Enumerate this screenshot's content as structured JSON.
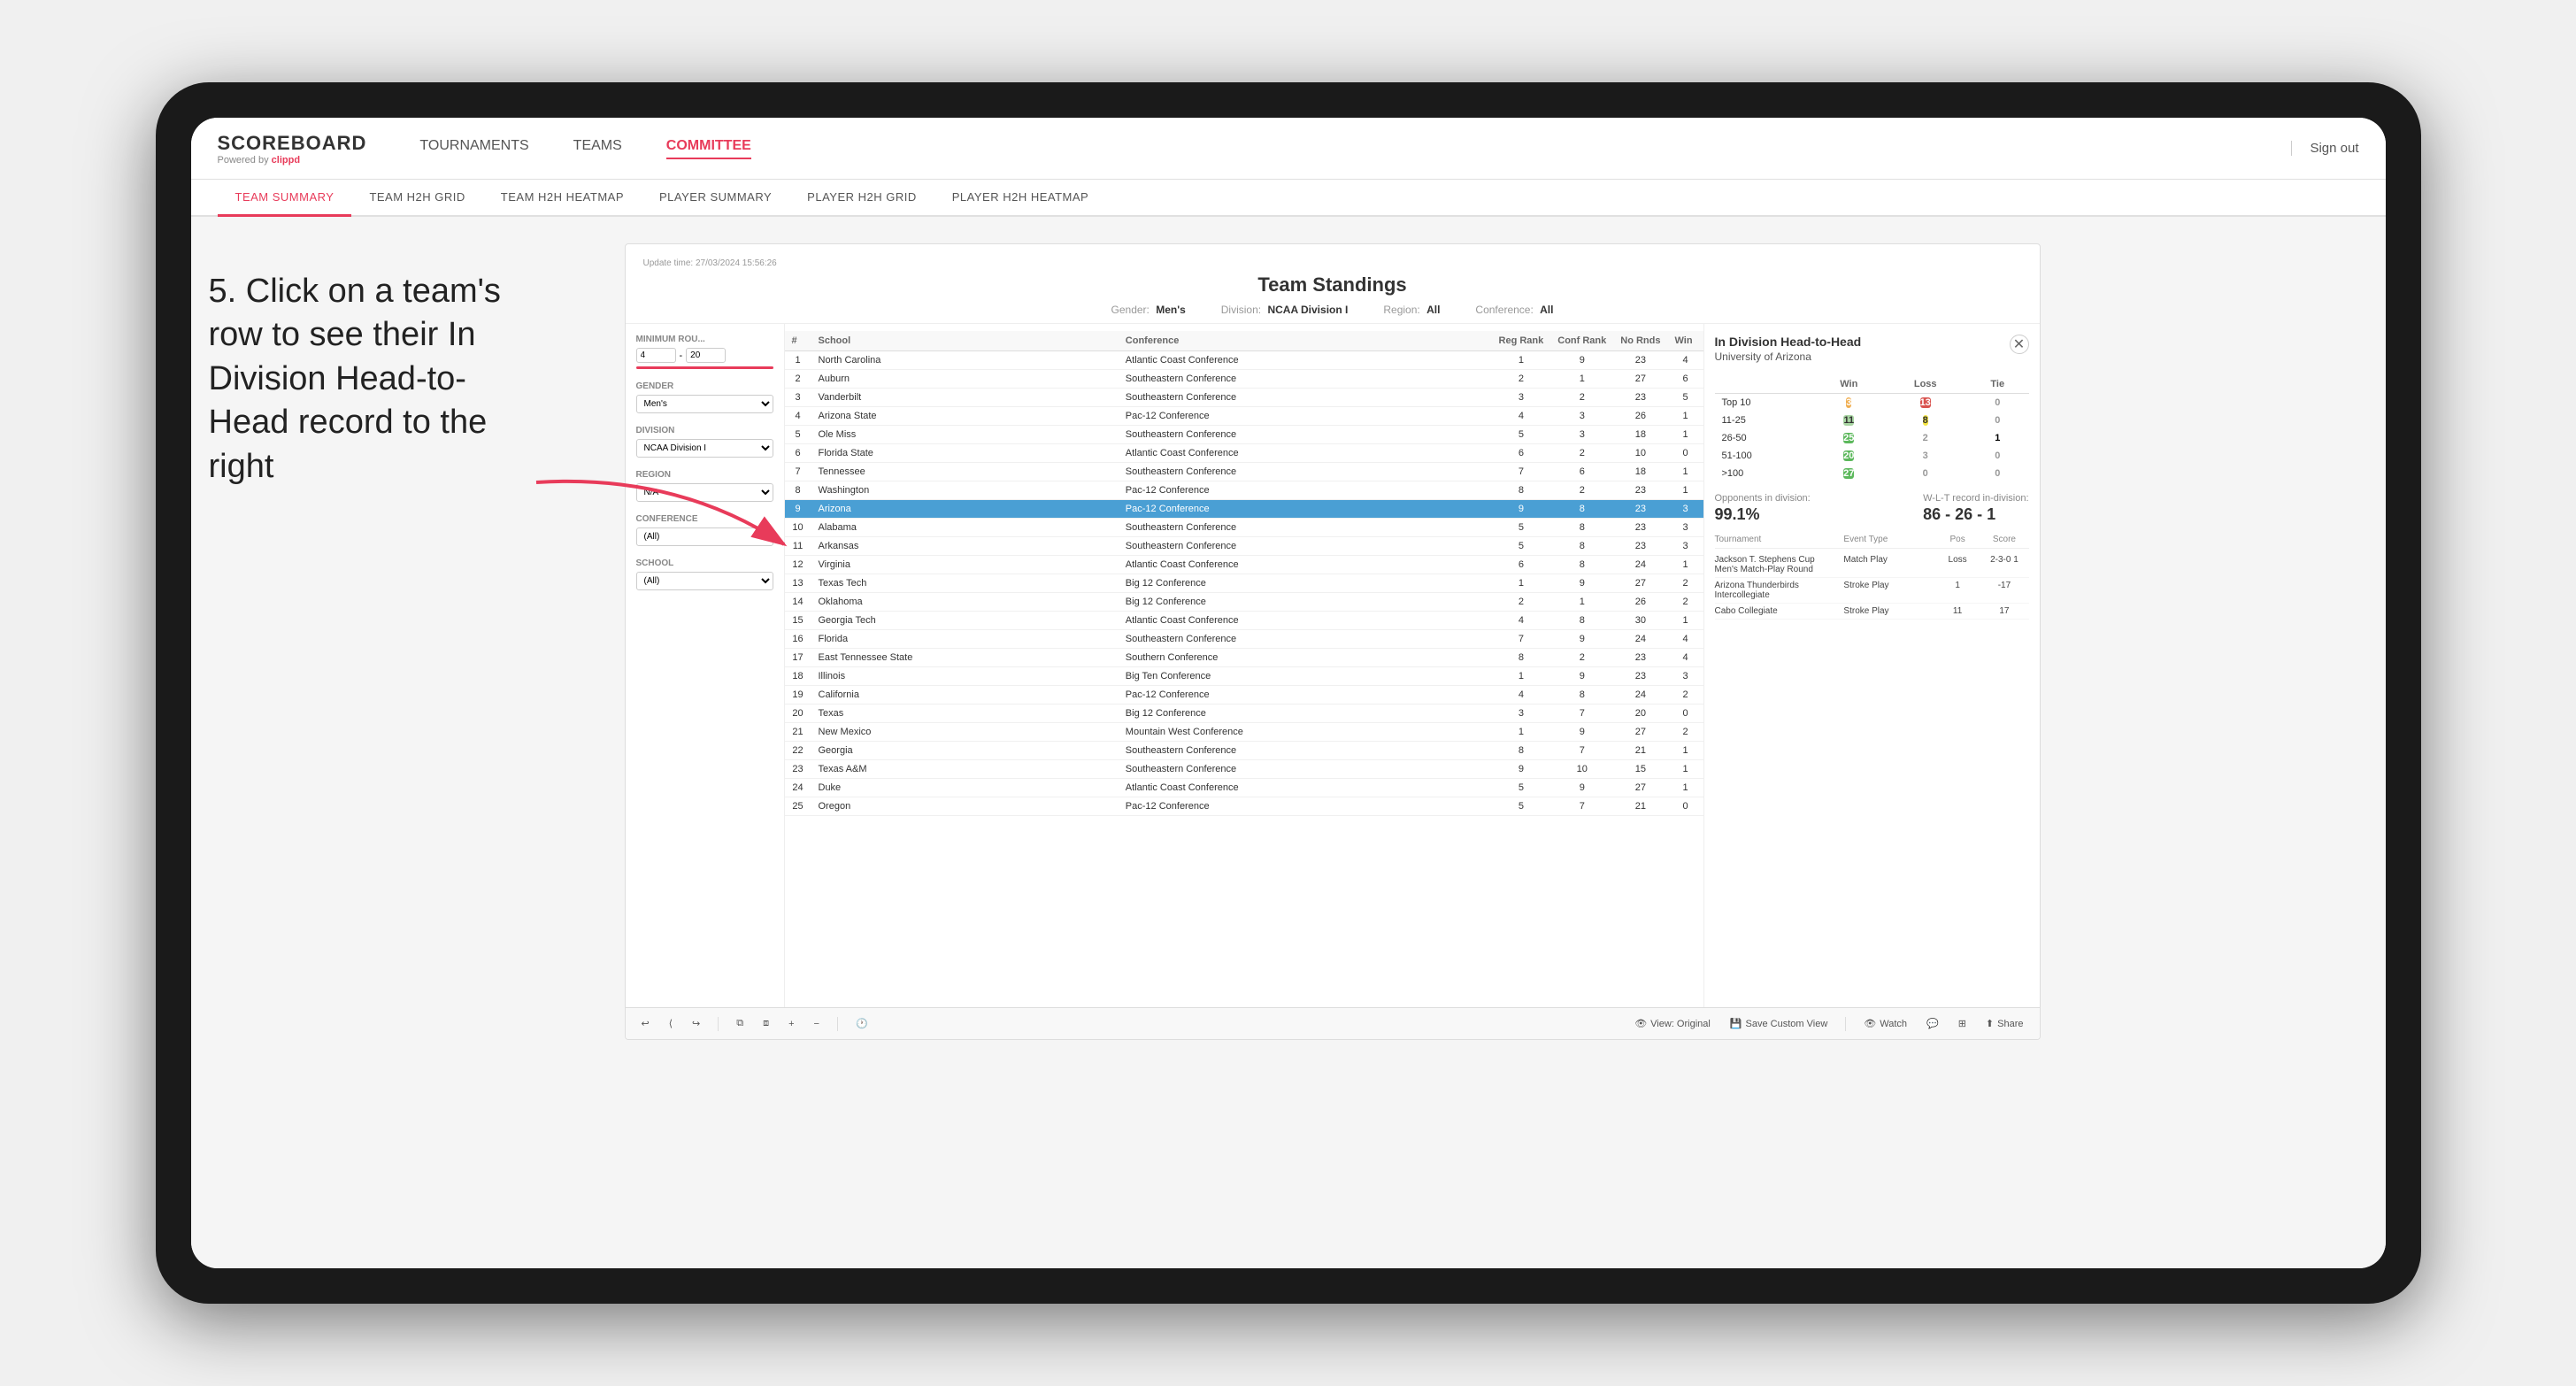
{
  "device": {
    "background_color": "#1a1a1a"
  },
  "annotation": {
    "text": "5. Click on a team's row to see their In Division Head-to-Head record to the right"
  },
  "top_nav": {
    "logo": "SCOREBOARD",
    "logo_sub": "Powered by ",
    "logo_brand": "clippd",
    "nav_items": [
      {
        "label": "TOURNAMENTS",
        "active": false
      },
      {
        "label": "TEAMS",
        "active": false
      },
      {
        "label": "COMMITTEE",
        "active": true
      }
    ],
    "sign_out": "Sign out"
  },
  "sub_nav": {
    "items": [
      {
        "label": "TEAM SUMMARY",
        "active": true
      },
      {
        "label": "TEAM H2H GRID",
        "active": false
      },
      {
        "label": "TEAM H2H HEATMAP",
        "active": false
      },
      {
        "label": "PLAYER SUMMARY",
        "active": false
      },
      {
        "label": "PLAYER H2H GRID",
        "active": false
      },
      {
        "label": "PLAYER H2H HEATMAP",
        "active": false
      }
    ]
  },
  "panel": {
    "update_time": "Update time: 27/03/2024 15:56:26",
    "title": "Team Standings",
    "filters": {
      "gender": {
        "label": "Gender:",
        "value": "Men's"
      },
      "division": {
        "label": "Division:",
        "value": "NCAA Division I"
      },
      "region": {
        "label": "Region:",
        "value": "All"
      },
      "conference": {
        "label": "Conference:",
        "value": "All"
      }
    }
  },
  "left_filters": {
    "minimum_rounds": {
      "label": "Minimum Rou...",
      "min": 4,
      "max": 20
    },
    "gender": {
      "label": "Gender",
      "value": "Men's"
    },
    "division": {
      "label": "Division",
      "value": "NCAA Division I"
    },
    "region": {
      "label": "Region",
      "value": "N/A"
    },
    "conference": {
      "label": "Conference",
      "value": "(All)"
    },
    "school": {
      "label": "School",
      "value": "(All)"
    }
  },
  "table": {
    "headers": [
      "#",
      "School",
      "Conference",
      "Reg Rank",
      "Conf Rank",
      "No Rnds",
      "Win"
    ],
    "rows": [
      {
        "rank": 1,
        "school": "North Carolina",
        "conference": "Atlantic Coast Conference",
        "reg_rank": 1,
        "conf_rank": 9,
        "rnds": 23,
        "win": 4,
        "selected": false
      },
      {
        "rank": 2,
        "school": "Auburn",
        "conference": "Southeastern Conference",
        "reg_rank": 2,
        "conf_rank": 1,
        "rnds": 27,
        "win": 6,
        "selected": false
      },
      {
        "rank": 3,
        "school": "Vanderbilt",
        "conference": "Southeastern Conference",
        "reg_rank": 3,
        "conf_rank": 2,
        "rnds": 23,
        "win": 5,
        "selected": false
      },
      {
        "rank": 4,
        "school": "Arizona State",
        "conference": "Pac-12 Conference",
        "reg_rank": 4,
        "conf_rank": 3,
        "rnds": 26,
        "win": 1,
        "selected": false
      },
      {
        "rank": 5,
        "school": "Ole Miss",
        "conference": "Southeastern Conference",
        "reg_rank": 5,
        "conf_rank": 3,
        "rnds": 18,
        "win": 1,
        "selected": false
      },
      {
        "rank": 6,
        "school": "Florida State",
        "conference": "Atlantic Coast Conference",
        "reg_rank": 6,
        "conf_rank": 2,
        "rnds": 10,
        "win": 0,
        "selected": false
      },
      {
        "rank": 7,
        "school": "Tennessee",
        "conference": "Southeastern Conference",
        "reg_rank": 7,
        "conf_rank": 6,
        "rnds": 18,
        "win": 1,
        "selected": false
      },
      {
        "rank": 8,
        "school": "Washington",
        "conference": "Pac-12 Conference",
        "reg_rank": 8,
        "conf_rank": 2,
        "rnds": 23,
        "win": 1,
        "selected": false
      },
      {
        "rank": 9,
        "school": "Arizona",
        "conference": "Pac-12 Conference",
        "reg_rank": 9,
        "conf_rank": 8,
        "rnds": 23,
        "win": 3,
        "selected": true
      },
      {
        "rank": 10,
        "school": "Alabama",
        "conference": "Southeastern Conference",
        "reg_rank": 5,
        "conf_rank": 8,
        "rnds": 23,
        "win": 3,
        "selected": false
      },
      {
        "rank": 11,
        "school": "Arkansas",
        "conference": "Southeastern Conference",
        "reg_rank": 5,
        "conf_rank": 8,
        "rnds": 23,
        "win": 3,
        "selected": false
      },
      {
        "rank": 12,
        "school": "Virginia",
        "conference": "Atlantic Coast Conference",
        "reg_rank": 6,
        "conf_rank": 8,
        "rnds": 24,
        "win": 1,
        "selected": false
      },
      {
        "rank": 13,
        "school": "Texas Tech",
        "conference": "Big 12 Conference",
        "reg_rank": 1,
        "conf_rank": 9,
        "rnds": 27,
        "win": 2,
        "selected": false
      },
      {
        "rank": 14,
        "school": "Oklahoma",
        "conference": "Big 12 Conference",
        "reg_rank": 2,
        "conf_rank": 1,
        "rnds": 26,
        "win": 2,
        "selected": false
      },
      {
        "rank": 15,
        "school": "Georgia Tech",
        "conference": "Atlantic Coast Conference",
        "reg_rank": 4,
        "conf_rank": 8,
        "rnds": 30,
        "win": 1,
        "selected": false
      },
      {
        "rank": 16,
        "school": "Florida",
        "conference": "Southeastern Conference",
        "reg_rank": 7,
        "conf_rank": 9,
        "rnds": 24,
        "win": 4,
        "selected": false
      },
      {
        "rank": 17,
        "school": "East Tennessee State",
        "conference": "Southern Conference",
        "reg_rank": 8,
        "conf_rank": 2,
        "rnds": 23,
        "win": 4,
        "selected": false
      },
      {
        "rank": 18,
        "school": "Illinois",
        "conference": "Big Ten Conference",
        "reg_rank": 1,
        "conf_rank": 9,
        "rnds": 23,
        "win": 3,
        "selected": false
      },
      {
        "rank": 19,
        "school": "California",
        "conference": "Pac-12 Conference",
        "reg_rank": 4,
        "conf_rank": 8,
        "rnds": 24,
        "win": 2,
        "selected": false
      },
      {
        "rank": 20,
        "school": "Texas",
        "conference": "Big 12 Conference",
        "reg_rank": 3,
        "conf_rank": 7,
        "rnds": 20,
        "win": 0,
        "selected": false
      },
      {
        "rank": 21,
        "school": "New Mexico",
        "conference": "Mountain West Conference",
        "reg_rank": 1,
        "conf_rank": 9,
        "rnds": 27,
        "win": 2,
        "selected": false
      },
      {
        "rank": 22,
        "school": "Georgia",
        "conference": "Southeastern Conference",
        "reg_rank": 8,
        "conf_rank": 7,
        "rnds": 21,
        "win": 1,
        "selected": false
      },
      {
        "rank": 23,
        "school": "Texas A&M",
        "conference": "Southeastern Conference",
        "reg_rank": 9,
        "conf_rank": 10,
        "rnds": 15,
        "win": 1,
        "selected": false
      },
      {
        "rank": 24,
        "school": "Duke",
        "conference": "Atlantic Coast Conference",
        "reg_rank": 5,
        "conf_rank": 9,
        "rnds": 27,
        "win": 1,
        "selected": false
      },
      {
        "rank": 25,
        "school": "Oregon",
        "conference": "Pac-12 Conference",
        "reg_rank": 5,
        "conf_rank": 7,
        "rnds": 21,
        "win": 0,
        "selected": false
      }
    ]
  },
  "h2h": {
    "title": "In Division Head-to-Head",
    "team": "University of Arizona",
    "headers": [
      "",
      "Win",
      "Loss",
      "Tie"
    ],
    "rows": [
      {
        "rank": "Top 10",
        "win": 3,
        "loss": 13,
        "tie": 0,
        "win_class": "cell-orange",
        "loss_class": "cell-red",
        "tie_class": "cell-0"
      },
      {
        "rank": "11-25",
        "win": 11,
        "loss": 8,
        "tie": 0,
        "win_class": "cell-light-green",
        "loss_class": "cell-yellow",
        "tie_class": "cell-0"
      },
      {
        "rank": "26-50",
        "win": 25,
        "loss": 2,
        "tie": 1,
        "win_class": "cell-green",
        "loss_class": "cell-0",
        "tie_class": "cell-0"
      },
      {
        "rank": "51-100",
        "win": 20,
        "loss": 3,
        "tie": 0,
        "win_class": "cell-green",
        "loss_class": "cell-0",
        "tie_class": "cell-0"
      },
      {
        "rank": ">100",
        "win": 27,
        "loss": 0,
        "tie": 0,
        "win_class": "cell-green",
        "loss_class": "cell-0",
        "tie_class": "cell-0"
      }
    ],
    "opponents_label": "Opponents in division:",
    "opponents_value": "99.1%",
    "wlt_label": "W-L-T record in-division:",
    "wlt_value": "86 - 26 - 1",
    "tournaments": {
      "header": [
        "Tournament",
        "Event Type",
        "Pos",
        "Score"
      ],
      "rows": [
        {
          "name": "Jackson T. Stephens Cup Men's Match-Play Round",
          "event": "Match Play",
          "pos": "Loss",
          "score": "2-3-0 1"
        },
        {
          "name": "Arizona Thunderbirds Intercollegiate",
          "event": "Stroke Play",
          "pos": "1",
          "score": "-17"
        },
        {
          "name": "Cabo Collegiate",
          "event": "Stroke Play",
          "pos": "11",
          "score": "17"
        }
      ]
    }
  },
  "toolbar": {
    "undo": "↩",
    "redo": "↪",
    "view_original": "View: Original",
    "save_custom": "Save Custom View",
    "watch": "Watch",
    "share": "Share"
  }
}
